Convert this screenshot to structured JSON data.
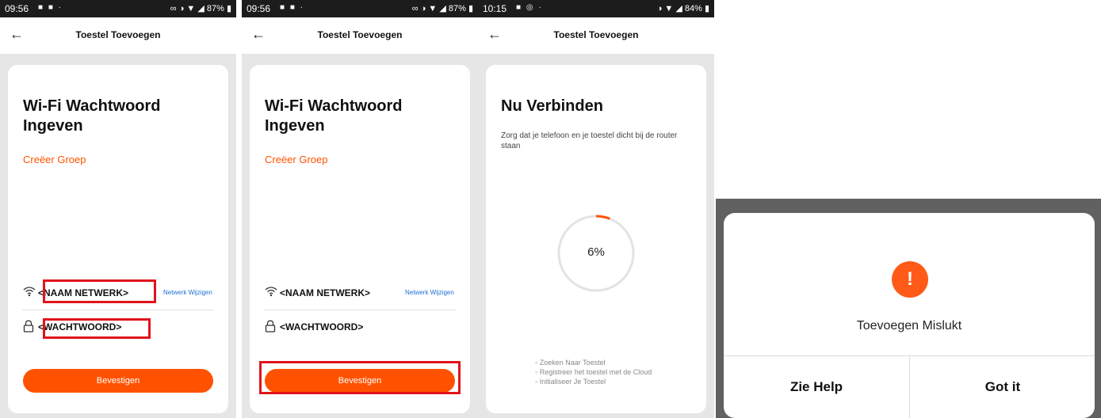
{
  "status": {
    "left_time": "09:56",
    "middle_time": "09:56",
    "right_time": "10:15",
    "battery_left": "87%",
    "battery_middle": "87%",
    "battery_right": "84%"
  },
  "nav": {
    "title": "Toestel Toevoegen",
    "back_glyph": "←"
  },
  "screen1": {
    "title": "Wi-Fi Wachtwoord Ingeven",
    "group_link": "Creëer Groep",
    "network_name": "<NAAM NETWERK>",
    "network_change": "Netwerk Wijzigen",
    "password": "<WACHTWOORD>",
    "confirm": "Bevestigen"
  },
  "screen2": {
    "title": "Wi-Fi Wachtwoord Ingeven",
    "group_link": "Creëer Groep",
    "network_name": "<NAAM NETWERK>",
    "network_change": "Netwerk Wijzigen",
    "password": "<WACHTWOORD>",
    "confirm": "Bevestigen"
  },
  "screen3": {
    "title": "Nu Verbinden",
    "subtitle": "Zorg dat je telefoon en je toestel dicht bij de router staan",
    "progress_label": "6%",
    "progress_value": 0.06,
    "steps": [
      "Zoeken Naar Toestel",
      "Registreer het toestel met de Cloud",
      "Initialiseer Je Toestel"
    ]
  },
  "dialog": {
    "icon_glyph": "!",
    "message": "Toevoegen Mislukt",
    "help_button": "Zie Help",
    "ok_button": "Got it"
  },
  "icons": {
    "wifi": "wifi-icon",
    "lock": "lock-icon",
    "back": "back-arrow-icon",
    "alert": "alert-icon"
  },
  "colors": {
    "accent": "#ff5200",
    "highlight_box": "#e0141c",
    "link_blue": "#1e6fd6"
  }
}
